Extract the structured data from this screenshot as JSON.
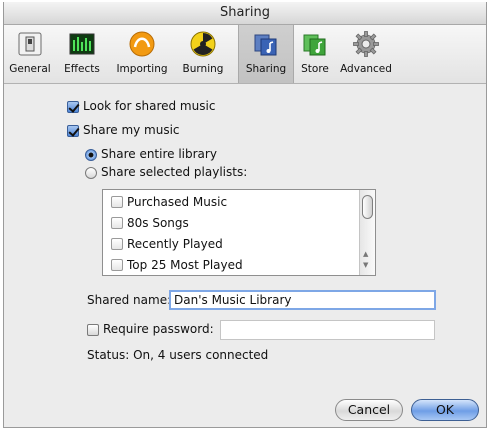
{
  "window": {
    "title": "Sharing"
  },
  "toolbar": {
    "items": [
      {
        "label": "General",
        "icon": "switch-icon",
        "selected": false
      },
      {
        "label": "Effects",
        "icon": "equalizer-icon",
        "selected": false
      },
      {
        "label": "Importing",
        "icon": "importing-icon",
        "selected": false
      },
      {
        "label": "Burning",
        "icon": "burning-icon",
        "selected": false
      },
      {
        "label": "Sharing",
        "icon": "sharing-icon",
        "selected": true
      },
      {
        "label": "Store",
        "icon": "store-icon",
        "selected": false
      },
      {
        "label": "Advanced",
        "icon": "gear-icon",
        "selected": false
      }
    ]
  },
  "options": {
    "look_for_shared": {
      "label": "Look for shared music",
      "checked": true
    },
    "share_my_music": {
      "label": "Share my music",
      "checked": true
    },
    "share_entire": {
      "label": "Share entire library",
      "selected": true
    },
    "share_selected": {
      "label": "Share selected playlists:",
      "selected": false
    }
  },
  "playlists": [
    {
      "label": "Purchased Music",
      "checked": false
    },
    {
      "label": "80s Songs",
      "checked": false
    },
    {
      "label": "Recently Played",
      "checked": false
    },
    {
      "label": "Top 25 Most Played",
      "checked": false
    }
  ],
  "shared_name": {
    "label": "Shared name:",
    "value": "Dan's Music Library"
  },
  "password": {
    "label": "Require password:",
    "checked": false,
    "value": ""
  },
  "status": {
    "text": "Status: On, 4 users connected"
  },
  "buttons": {
    "cancel": "Cancel",
    "ok": "OK"
  },
  "colors": {
    "accent": "#4f86d8",
    "ok_button": "#6f9ee6"
  }
}
